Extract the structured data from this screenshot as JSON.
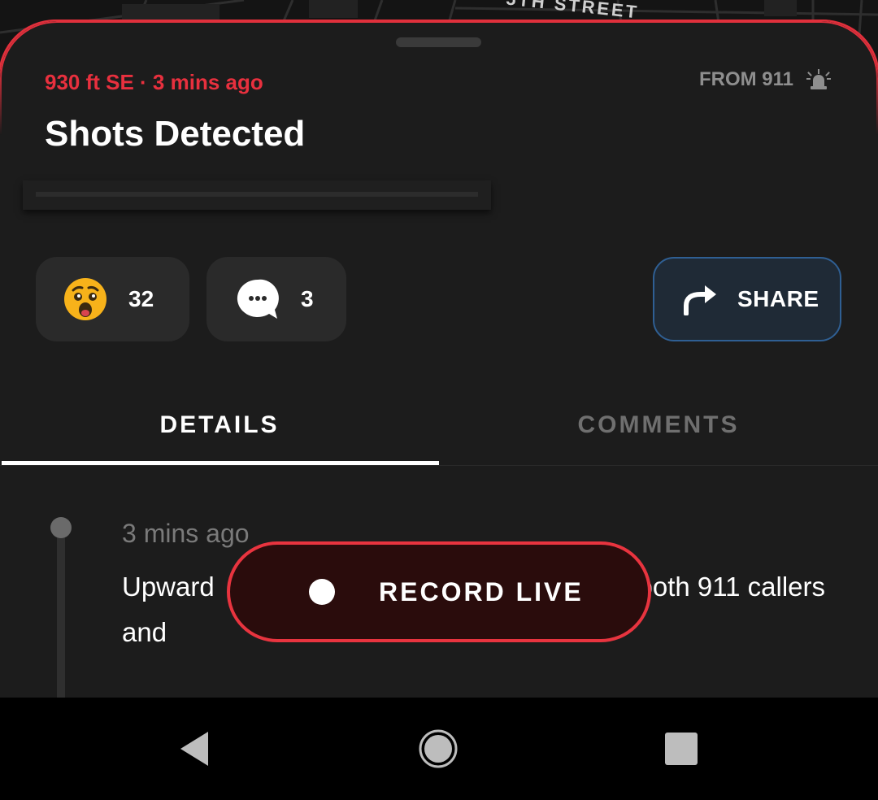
{
  "map": {
    "street_label": "5TH STREET"
  },
  "alert": {
    "distance_time": "930 ft SE · 3 mins ago",
    "source_label": "FROM 911",
    "source_icon": "siren-icon",
    "title": "Shots Detected"
  },
  "actions": {
    "reaction_icon": "shocked-face-icon",
    "reaction_count": "32",
    "comment_icon": "chat-bubble-icon",
    "comment_count": "3",
    "share_icon": "share-arrow-icon",
    "share_label": "SHARE"
  },
  "tabs": [
    {
      "label": "DETAILS",
      "active": true
    },
    {
      "label": "COMMENTS",
      "active": false
    }
  ],
  "details": {
    "entries": [
      {
        "time": "3 mins ago",
        "text": "Upward                                                    by both 911 callers and"
      }
    ]
  },
  "record": {
    "label": "RECORD LIVE"
  },
  "navbar": {
    "back_icon": "back-triangle-icon",
    "home_icon": "home-circle-icon",
    "recent_icon": "recent-square-icon"
  },
  "colors": {
    "accent_red": "#e8303e",
    "share_border": "#2f5f93",
    "sheet_bg": "#1c1c1c"
  }
}
